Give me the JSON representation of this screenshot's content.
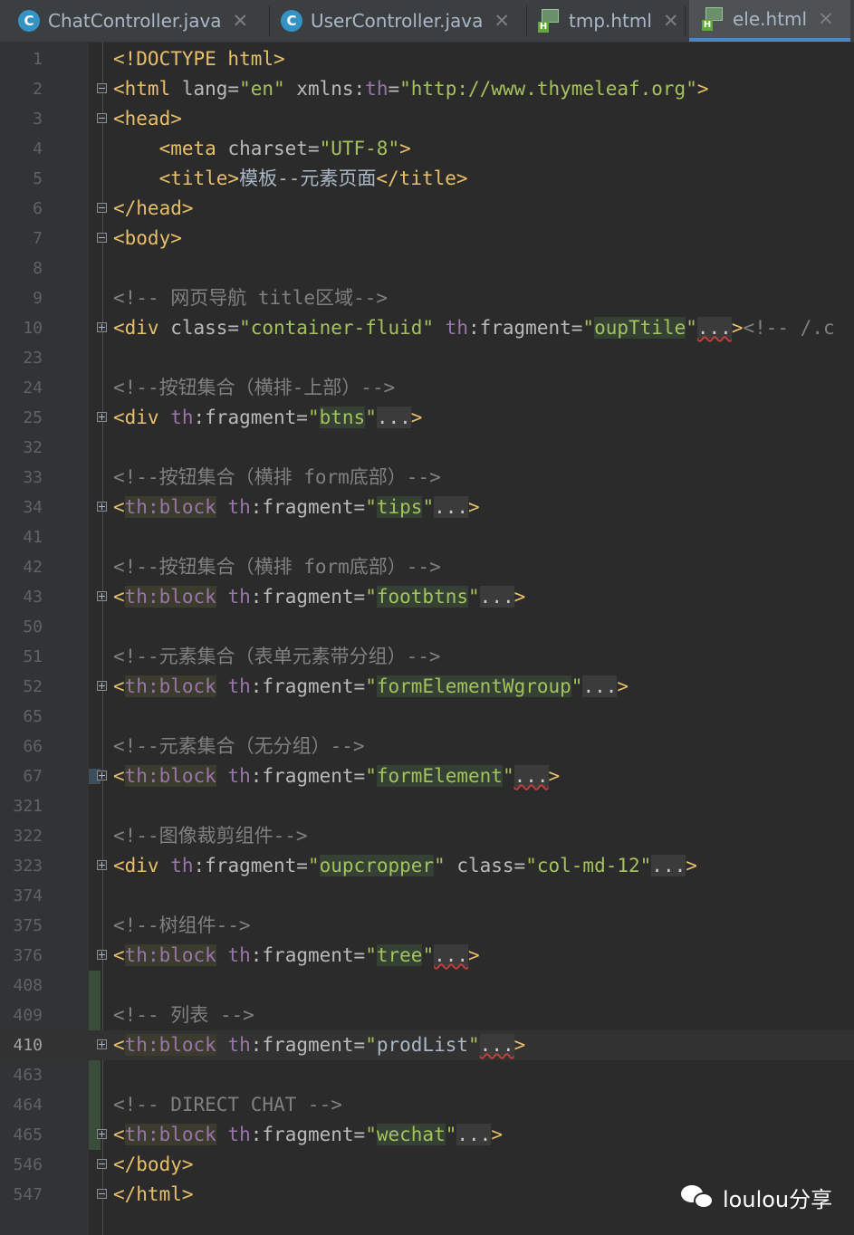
{
  "tabs": [
    {
      "label": "ChatController.java",
      "icon": "java-class-icon",
      "active": false
    },
    {
      "label": "UserController.java",
      "icon": "java-class-icon",
      "active": false
    },
    {
      "label": "tmp.html",
      "icon": "html-file-icon",
      "active": false
    },
    {
      "label": "ele.html",
      "icon": "html-file-icon",
      "active": true
    }
  ],
  "tab_close_glyph": "✕",
  "java_icon_letter": "C",
  "html_icon_letter": "H",
  "lines": [
    {
      "n": "1",
      "fold": "none",
      "segs": [
        [
          "tag",
          "<!DOCTYPE html>"
        ]
      ]
    },
    {
      "n": "2",
      "fold": "open",
      "segs": [
        [
          "tag",
          "<html "
        ],
        [
          "attr",
          "lang="
        ],
        [
          "str",
          "\"en\""
        ],
        [
          "attr",
          " xmlns:"
        ],
        [
          "ns",
          "th"
        ],
        [
          "attr",
          "="
        ],
        [
          "str",
          "\"http://www.thymeleaf.org\""
        ],
        [
          "tag",
          ">"
        ]
      ]
    },
    {
      "n": "3",
      "fold": "open",
      "segs": [
        [
          "tag",
          "<head>"
        ]
      ]
    },
    {
      "n": "4",
      "fold": "none",
      "segs": [
        [
          "txt",
          "    "
        ],
        [
          "tag",
          "<meta "
        ],
        [
          "attr",
          "charset="
        ],
        [
          "str",
          "\"UTF-8\""
        ],
        [
          "tag",
          ">"
        ]
      ]
    },
    {
      "n": "5",
      "fold": "none",
      "segs": [
        [
          "txt",
          "    "
        ],
        [
          "tag",
          "<title>"
        ],
        [
          "txt",
          "模板--元素页面"
        ],
        [
          "tag",
          "</title>"
        ]
      ]
    },
    {
      "n": "6",
      "fold": "open",
      "segs": [
        [
          "tag",
          "</head>"
        ]
      ]
    },
    {
      "n": "7",
      "fold": "open",
      "segs": [
        [
          "tag",
          "<body>"
        ]
      ]
    },
    {
      "n": "8",
      "fold": "none",
      "segs": []
    },
    {
      "n": "9",
      "fold": "none",
      "segs": [
        [
          "cmt",
          "<!-- 网页导航 title区域-->"
        ]
      ]
    },
    {
      "n": "10",
      "fold": "plus",
      "segs": [
        [
          "tag",
          "<div "
        ],
        [
          "attr",
          "class="
        ],
        [
          "str",
          "\"container-fluid\""
        ],
        [
          "attr",
          " "
        ],
        [
          "ns",
          "th"
        ],
        [
          "attr",
          ":fragment="
        ],
        [
          "str",
          "\""
        ],
        [
          "hl2",
          "oupTtile"
        ],
        [
          "str",
          "\""
        ],
        [
          "flde",
          "..."
        ],
        [
          "tag",
          ">"
        ],
        [
          "cmt",
          "<!-- /.c"
        ]
      ]
    },
    {
      "n": "23",
      "fold": "none",
      "segs": []
    },
    {
      "n": "24",
      "fold": "none",
      "segs": [
        [
          "cmt",
          "<!--按钮集合（横排-上部）-->"
        ]
      ]
    },
    {
      "n": "25",
      "fold": "plus",
      "segs": [
        [
          "tag",
          "<div "
        ],
        [
          "ns",
          "th"
        ],
        [
          "attr",
          ":fragment="
        ],
        [
          "str",
          "\""
        ],
        [
          "hl2",
          "btns"
        ],
        [
          "str",
          "\""
        ],
        [
          "fld",
          "..."
        ],
        [
          "tag",
          ">"
        ]
      ]
    },
    {
      "n": "32",
      "fold": "none",
      "segs": []
    },
    {
      "n": "33",
      "fold": "none",
      "segs": [
        [
          "cmt",
          "<!--按钮集合（横排 form底部）-->"
        ]
      ]
    },
    {
      "n": "34",
      "fold": "plus",
      "segs": [
        [
          "tag",
          "<"
        ],
        [
          "hltag",
          "th:block"
        ],
        [
          "attr",
          " "
        ],
        [
          "ns",
          "th"
        ],
        [
          "attr",
          ":fragment="
        ],
        [
          "str",
          "\""
        ],
        [
          "hl2",
          "tips"
        ],
        [
          "str",
          "\""
        ],
        [
          "fld",
          "..."
        ],
        [
          "tag",
          ">"
        ]
      ]
    },
    {
      "n": "41",
      "fold": "none",
      "segs": []
    },
    {
      "n": "42",
      "fold": "none",
      "segs": [
        [
          "cmt",
          "<!--按钮集合（横排 form底部）-->"
        ]
      ]
    },
    {
      "n": "43",
      "fold": "plus",
      "segs": [
        [
          "tag",
          "<"
        ],
        [
          "hltag",
          "th:block"
        ],
        [
          "attr",
          " "
        ],
        [
          "ns",
          "th"
        ],
        [
          "attr",
          ":fragment="
        ],
        [
          "str",
          "\""
        ],
        [
          "hl2",
          "footbtns"
        ],
        [
          "str",
          "\""
        ],
        [
          "fld",
          "..."
        ],
        [
          "tag",
          ">"
        ]
      ]
    },
    {
      "n": "50",
      "fold": "none",
      "segs": []
    },
    {
      "n": "51",
      "fold": "none",
      "segs": [
        [
          "cmt",
          "<!--元素集合（表单元素带分组）-->"
        ]
      ]
    },
    {
      "n": "52",
      "fold": "plus",
      "segs": [
        [
          "tag",
          "<"
        ],
        [
          "hltag",
          "th:block"
        ],
        [
          "attr",
          " "
        ],
        [
          "ns",
          "th"
        ],
        [
          "attr",
          ":fragment="
        ],
        [
          "str",
          "\""
        ],
        [
          "hl2",
          "formElementWgroup"
        ],
        [
          "str",
          "\""
        ],
        [
          "fld",
          "..."
        ],
        [
          "tag",
          ">"
        ]
      ]
    },
    {
      "n": "65",
      "fold": "none",
      "segs": []
    },
    {
      "n": "66",
      "fold": "none",
      "segs": [
        [
          "cmt",
          "<!--元素集合（无分组）-->"
        ]
      ]
    },
    {
      "n": "67",
      "fold": "plus",
      "segs": [
        [
          "tag",
          "<"
        ],
        [
          "hltag",
          "th:block"
        ],
        [
          "attr",
          " "
        ],
        [
          "ns",
          "th"
        ],
        [
          "attr",
          ":fragment="
        ],
        [
          "str",
          "\""
        ],
        [
          "hl2",
          "formElement"
        ],
        [
          "str",
          "\""
        ],
        [
          "flde",
          "..."
        ],
        [
          "tag",
          ">"
        ]
      ]
    },
    {
      "n": "321",
      "fold": "none",
      "segs": []
    },
    {
      "n": "322",
      "fold": "none",
      "segs": [
        [
          "cmt",
          "<!--图像裁剪组件-->"
        ]
      ]
    },
    {
      "n": "323",
      "fold": "plus",
      "segs": [
        [
          "tag",
          "<div "
        ],
        [
          "ns",
          "th"
        ],
        [
          "attr",
          ":fragment="
        ],
        [
          "str",
          "\""
        ],
        [
          "hl2",
          "oupcropper"
        ],
        [
          "str",
          "\""
        ],
        [
          "attr",
          " class="
        ],
        [
          "str",
          "\"col-md-12\""
        ],
        [
          "fld",
          "..."
        ],
        [
          "tag",
          ">"
        ]
      ]
    },
    {
      "n": "374",
      "fold": "none",
      "segs": []
    },
    {
      "n": "375",
      "fold": "none",
      "segs": [
        [
          "cmt",
          "<!--树组件-->"
        ]
      ]
    },
    {
      "n": "376",
      "fold": "plus",
      "segs": [
        [
          "tag",
          "<"
        ],
        [
          "hltag",
          "th:block"
        ],
        [
          "attr",
          " "
        ],
        [
          "ns",
          "th"
        ],
        [
          "attr",
          ":fragment="
        ],
        [
          "str",
          "\""
        ],
        [
          "hl2",
          "tree"
        ],
        [
          "str",
          "\""
        ],
        [
          "flde",
          "..."
        ],
        [
          "tag",
          ">"
        ]
      ]
    },
    {
      "n": "408",
      "fold": "none",
      "segs": []
    },
    {
      "n": "409",
      "fold": "none",
      "segs": [
        [
          "cmt",
          "<!-- 列表 -->"
        ]
      ]
    },
    {
      "n": "410",
      "fold": "plus",
      "current": true,
      "segs": [
        [
          "tag",
          "<"
        ],
        [
          "hltag",
          "th:block"
        ],
        [
          "attr",
          " "
        ],
        [
          "ns",
          "th"
        ],
        [
          "attr",
          ":fragment="
        ],
        [
          "strhl",
          "\""
        ],
        [
          "txt",
          "prodList"
        ],
        [
          "str",
          "\""
        ],
        [
          "flde",
          "..."
        ],
        [
          "tag",
          ">"
        ]
      ]
    },
    {
      "n": "463",
      "fold": "none",
      "segs": []
    },
    {
      "n": "464",
      "fold": "none",
      "segs": [
        [
          "cmt",
          "<!-- DIRECT CHAT -->"
        ]
      ]
    },
    {
      "n": "465",
      "fold": "plus",
      "segs": [
        [
          "tag",
          "<"
        ],
        [
          "hltag",
          "th:block"
        ],
        [
          "attr",
          " "
        ],
        [
          "ns",
          "th"
        ],
        [
          "attr",
          ":fragment="
        ],
        [
          "str",
          "\""
        ],
        [
          "hl2",
          "wechat"
        ],
        [
          "str",
          "\""
        ],
        [
          "fld",
          "..."
        ],
        [
          "tag",
          ">"
        ]
      ]
    },
    {
      "n": "546",
      "fold": "open",
      "segs": [
        [
          "tag",
          "</body>"
        ]
      ]
    },
    {
      "n": "547",
      "fold": "open",
      "segs": [
        [
          "tag",
          "</html>"
        ]
      ]
    }
  ],
  "watermark": {
    "text": "loulou分享",
    "icon": "wechat-icon"
  },
  "colors": {
    "background": "#2b2b2b",
    "tag": "#e8bf6a",
    "string": "#a5c25c",
    "namespace": "#9876aa",
    "comment": "#808080",
    "active_tab_underline": "#4a88c7"
  }
}
